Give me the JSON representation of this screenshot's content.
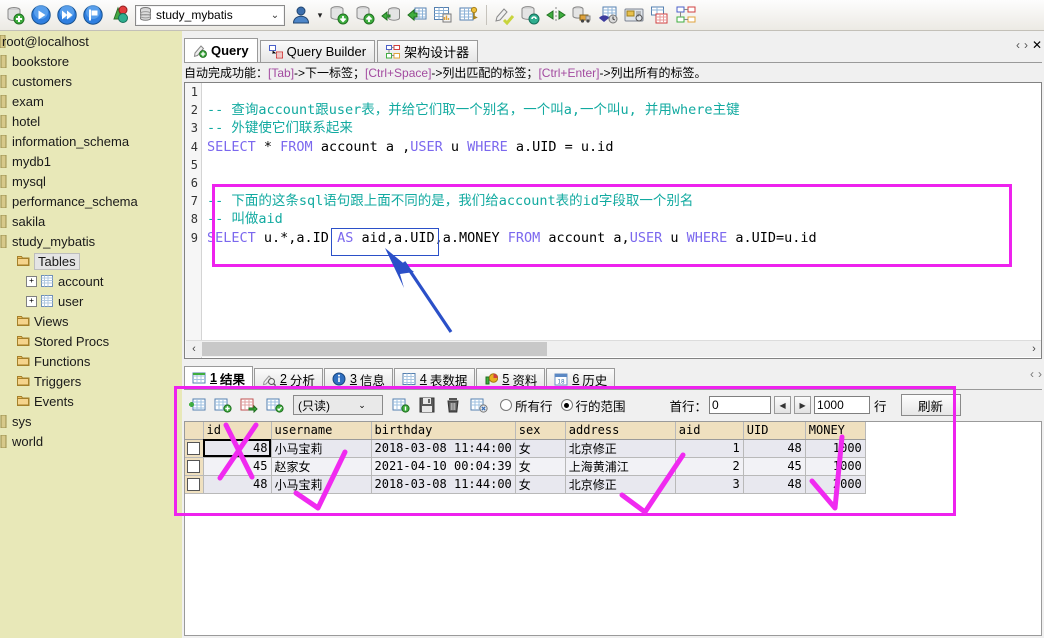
{
  "toolbar": {
    "icons": [
      {
        "name": "new-connection-icon",
        "label": "New Connection"
      },
      {
        "name": "run-icon",
        "label": "Run"
      },
      {
        "name": "run-all-icon",
        "label": "Run All"
      },
      {
        "name": "stop-icon",
        "label": "Stop"
      },
      {
        "name": "compare-icon",
        "label": "Compare"
      }
    ],
    "database_selector": {
      "value": "study_mybatis",
      "icon": "database-icon",
      "caret": "⌄"
    },
    "user_icon": "user-icon",
    "right_icons": [
      {
        "name": "import-database-icon"
      },
      {
        "name": "export-database-icon"
      },
      {
        "name": "backup-database-icon"
      },
      {
        "name": "export-table-icon"
      },
      {
        "name": "table-report-icon"
      },
      {
        "name": "table-keys-icon"
      },
      {
        "name": "sql-dump-icon"
      },
      {
        "name": "refresh-database-icon"
      },
      {
        "name": "sync-icon"
      },
      {
        "name": "data-transfer-icon"
      },
      {
        "name": "scheduler-icon"
      },
      {
        "name": "monitor-icon"
      },
      {
        "name": "table-designer-icon"
      },
      {
        "name": "schema-designer-icon"
      }
    ]
  },
  "sidebar": {
    "root": "root@localhost",
    "databases": [
      "bookstore",
      "customers",
      "exam",
      "hotel",
      "information_schema",
      "mydb1",
      "mysql",
      "performance_schema",
      "sakila",
      "study_mybatis"
    ],
    "study_mybatis_children": [
      {
        "label": "Tables",
        "selected": true
      },
      {
        "label": "Views",
        "selected": false
      },
      {
        "label": "Stored Procs",
        "selected": false
      },
      {
        "label": "Functions",
        "selected": false
      },
      {
        "label": "Triggers",
        "selected": false
      },
      {
        "label": "Events",
        "selected": false
      }
    ],
    "tables": [
      "account",
      "user"
    ],
    "trailing": [
      "sys",
      "world"
    ]
  },
  "tabs": [
    {
      "label": "Query",
      "icon": "query-icon",
      "active": true
    },
    {
      "label": "Query Builder",
      "icon": "query-builder-icon",
      "active": false
    },
    {
      "label": "架构设计器",
      "icon": "schema-designer-icon",
      "active": false
    }
  ],
  "tab_nav": {
    "prev": "‹",
    "next": "›",
    "close": "✕"
  },
  "hint": {
    "prefix": "自动完成功能：",
    "segments": [
      {
        "key": "[Tab]",
        "text": "->下一标签；"
      },
      {
        "key": "[Ctrl+Space]",
        "text": "->列出匹配的标签；"
      },
      {
        "key": "[Ctrl+Enter]",
        "text": "->列出所有的标签。"
      }
    ]
  },
  "editor": {
    "line_numbers": [
      "1",
      "2",
      "3",
      "4",
      "5",
      "6",
      "7",
      "8",
      "9"
    ],
    "lines": [
      {
        "n": 1,
        "parts": []
      },
      {
        "n": 2,
        "parts": [
          {
            "t": "-- 查询account跟user表，并给它们取一个别名，一个叫a,一个叫u, 并用where主键",
            "c": "cmt"
          }
        ]
      },
      {
        "n": 3,
        "parts": [
          {
            "t": "-- 外键使它们联系起来",
            "c": "cmt"
          }
        ]
      },
      {
        "n": 4,
        "parts": [
          {
            "t": "SELECT",
            "c": "kw"
          },
          {
            "t": " * ",
            "c": "plain"
          },
          {
            "t": "FROM",
            "c": "kw"
          },
          {
            "t": " account a ,",
            "c": "plain"
          },
          {
            "t": "USER",
            "c": "kw"
          },
          {
            "t": " u ",
            "c": "plain"
          },
          {
            "t": "WHERE",
            "c": "kw"
          },
          {
            "t": " a.UID = u.id",
            "c": "plain"
          }
        ]
      },
      {
        "n": 5,
        "parts": []
      },
      {
        "n": 6,
        "parts": []
      },
      {
        "n": 7,
        "parts": [
          {
            "t": "-- 下面的这条sql语句跟上面不同的是，我们给account表的id字段取一个别名",
            "c": "cmt"
          }
        ]
      },
      {
        "n": 8,
        "parts": [
          {
            "t": "-- 叫做aid",
            "c": "cmt"
          }
        ]
      },
      {
        "n": 9,
        "parts": [
          {
            "t": "SELECT",
            "c": "kw"
          },
          {
            "t": " u.*,a.ID ",
            "c": "plain"
          },
          {
            "t": "AS",
            "c": "kw"
          },
          {
            "t": " aid,a.UID,a.MONEY ",
            "c": "plain"
          },
          {
            "t": "FROM",
            "c": "kw"
          },
          {
            "t": " account a,",
            "c": "plain"
          },
          {
            "t": "USER",
            "c": "kw"
          },
          {
            "t": " u ",
            "c": "plain"
          },
          {
            "t": "WHERE",
            "c": "kw"
          },
          {
            "t": " a.UID=u.id",
            "c": "plain"
          }
        ]
      }
    ],
    "scroll_left_arrow": "‹",
    "scroll_right_arrow": "›"
  },
  "result_tabs": [
    {
      "num": "1",
      "label": "结果",
      "icon": "result-grid-icon",
      "active": true
    },
    {
      "num": "2",
      "label": "分析",
      "icon": "profile-icon",
      "active": false
    },
    {
      "num": "3",
      "label": "信息",
      "icon": "info-icon",
      "active": false
    },
    {
      "num": "4",
      "label": "表数据",
      "icon": "table-data-icon",
      "active": false
    },
    {
      "num": "5",
      "label": "资料",
      "icon": "stats-icon",
      "active": false
    },
    {
      "num": "6",
      "label": "历史",
      "icon": "history-icon",
      "active": false
    }
  ],
  "result_toolbar": {
    "icons": [
      "insert-row-icon",
      "duplicate-row-icon",
      "copy-row-icon",
      "paste-row-icon"
    ],
    "mode_select": {
      "value": "(只读)",
      "caret": "⌄"
    },
    "icons2": [
      "export-grid-icon",
      "save-icon",
      "delete-icon",
      "remove-row-icon"
    ],
    "radio_all": {
      "label": "所有行",
      "checked": false
    },
    "radio_range": {
      "label": "行的范围",
      "checked": true
    },
    "first_row_label": "首行：",
    "first_row_value": "0",
    "prev_arrow": "◀",
    "next_arrow": "▶",
    "count_value": "1000",
    "rows_label": "行",
    "refresh_label": "刷新"
  },
  "grid": {
    "columns": [
      "id",
      "username",
      "birthday",
      "sex",
      "address",
      "aid",
      "UID",
      "MONEY"
    ],
    "rows": [
      {
        "checked": false,
        "id": "48",
        "username": "小马宝莉",
        "birthday": "2018-03-08 11:44:00",
        "sex": "女",
        "address": "北京修正",
        "aid": "1",
        "UID": "48",
        "MONEY": "1000"
      },
      {
        "checked": false,
        "id": "45",
        "username": "赵家女",
        "birthday": "2021-04-10 00:04:39",
        "sex": "女",
        "address": "上海黄浦江",
        "aid": "2",
        "UID": "45",
        "MONEY": "1000"
      },
      {
        "checked": false,
        "id": "48",
        "username": "小马宝莉",
        "birthday": "2018-03-08 11:44:00",
        "sex": "女",
        "address": "北京修正",
        "aid": "3",
        "UID": "48",
        "MONEY": "2000"
      }
    ]
  },
  "annotations": {
    "highlight_color": "#ee22ee",
    "arrow_color": "#2b50c8",
    "marks": [
      {
        "name": "cross-mark-id-column"
      },
      {
        "name": "check-mark-username-column"
      },
      {
        "name": "check-mark-address-column"
      },
      {
        "name": "check-mark-uid-column"
      },
      {
        "name": "arrow-to-alias"
      }
    ]
  }
}
